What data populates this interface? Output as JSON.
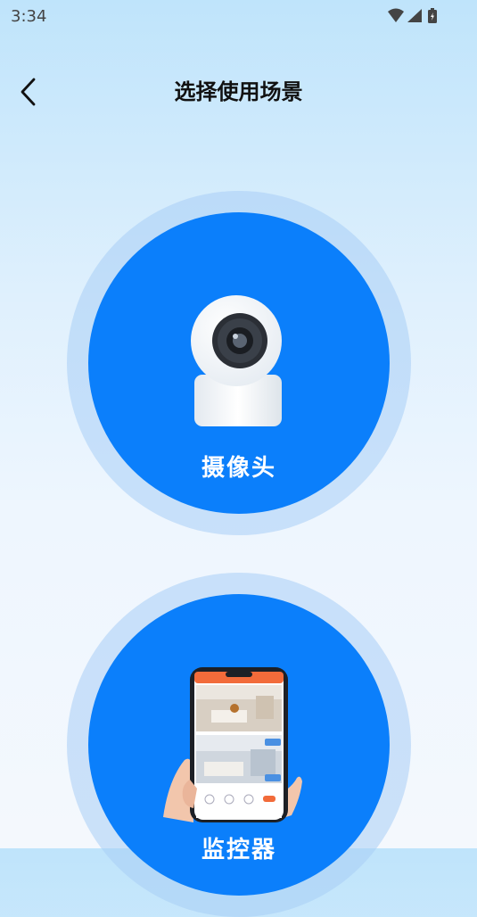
{
  "status_bar": {
    "time": "3:34"
  },
  "header": {
    "title": "选择使用场景"
  },
  "scenes": [
    {
      "label": "摄像头",
      "icon": "security-camera"
    },
    {
      "label": "监控器",
      "icon": "phone-monitor"
    }
  ],
  "colors": {
    "accent": "#0b7ffb",
    "ring": "#a7cdf6"
  }
}
